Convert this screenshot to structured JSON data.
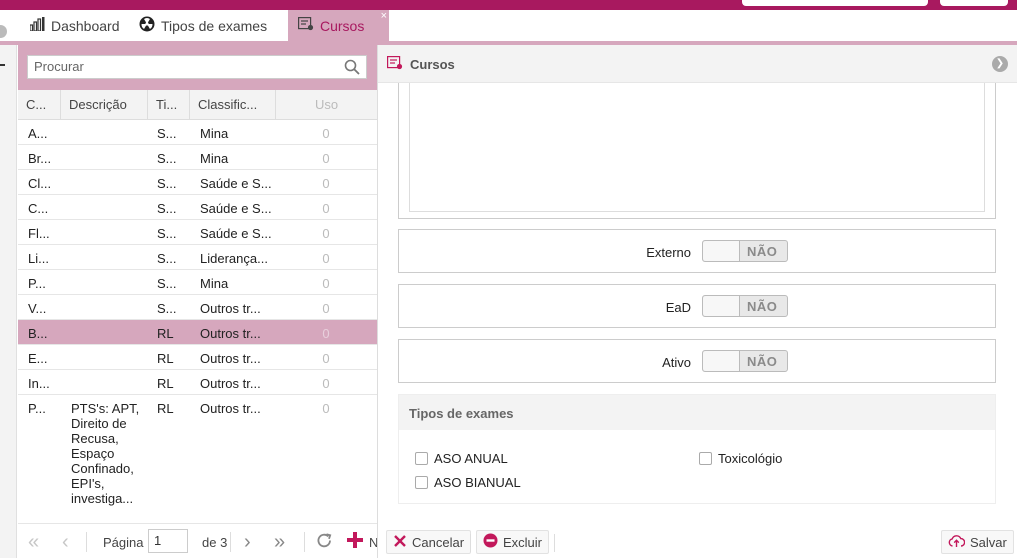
{
  "tabs": [
    {
      "label": "Dashboard",
      "icon": "bar-chart-icon",
      "active": false
    },
    {
      "label": "Tipos de exames",
      "icon": "radiation-icon",
      "active": false
    },
    {
      "label": "Cursos",
      "icon": "course-icon",
      "active": true
    }
  ],
  "tab_close": "×",
  "search": {
    "placeholder": "Procurar"
  },
  "table": {
    "headers": [
      "C...",
      "Descrição",
      "Ti...",
      "Classific...",
      "Uso"
    ],
    "rows": [
      {
        "c": "A...",
        "desc": "",
        "ti": "S...",
        "cls": "Mina",
        "uso": "0",
        "selected": false
      },
      {
        "c": "Br...",
        "desc": "",
        "ti": "S...",
        "cls": "Mina",
        "uso": "0",
        "selected": false
      },
      {
        "c": "Cl...",
        "desc": "",
        "ti": "S...",
        "cls": "Saúde e S...",
        "uso": "0",
        "selected": false
      },
      {
        "c": "C...",
        "desc": "",
        "ti": "S...",
        "cls": "Saúde e S...",
        "uso": "0",
        "selected": false
      },
      {
        "c": "Fl...",
        "desc": "",
        "ti": "S...",
        "cls": "Saúde e S...",
        "uso": "0",
        "selected": false
      },
      {
        "c": "Li...",
        "desc": "",
        "ti": "S...",
        "cls": "Liderança...",
        "uso": "0",
        "selected": false
      },
      {
        "c": "P...",
        "desc": "",
        "ti": "S...",
        "cls": "Mina",
        "uso": "0",
        "selected": false
      },
      {
        "c": "V...",
        "desc": "",
        "ti": "S...",
        "cls": "Outros tr...",
        "uso": "0",
        "selected": false
      },
      {
        "c": "B...",
        "desc": "",
        "ti": "RL",
        "cls": "Outros tr...",
        "uso": "0",
        "selected": true
      },
      {
        "c": "E...",
        "desc": "",
        "ti": "RL",
        "cls": "Outros tr...",
        "uso": "0",
        "selected": false
      },
      {
        "c": "In...",
        "desc": "",
        "ti": "RL",
        "cls": "Outros tr...",
        "uso": "0",
        "selected": false
      },
      {
        "c": "P...",
        "desc": "PTS's: APT, Direito de Recusa, Espaço Confinado, EPI's, investiga... de",
        "ti": "RL",
        "cls": "Outros tr...",
        "uso": "0",
        "selected": false
      }
    ]
  },
  "pager": {
    "page_label": "Página",
    "page_value": "1",
    "of_label": "de 3",
    "new_label": "N"
  },
  "detail": {
    "title": "Cursos",
    "fields": [
      {
        "label": "Externo",
        "value": "NÃO"
      },
      {
        "label": "EaD",
        "value": "NÃO"
      },
      {
        "label": "Ativo",
        "value": "NÃO"
      }
    ],
    "exams": {
      "title": "Tipos de exames",
      "options": [
        {
          "label": "ASO ANUAL",
          "checked": false
        },
        {
          "label": "ASO BIANUAL",
          "checked": false
        },
        {
          "label": "Toxicológio",
          "checked": false
        }
      ]
    },
    "buttons": {
      "cancel": "Cancelar",
      "delete": "Excluir",
      "save": "Salvar"
    }
  },
  "colors": {
    "brand": "#a8195f",
    "accent_light": "#d6a7bd",
    "cancel_icon": "#c2185b"
  }
}
